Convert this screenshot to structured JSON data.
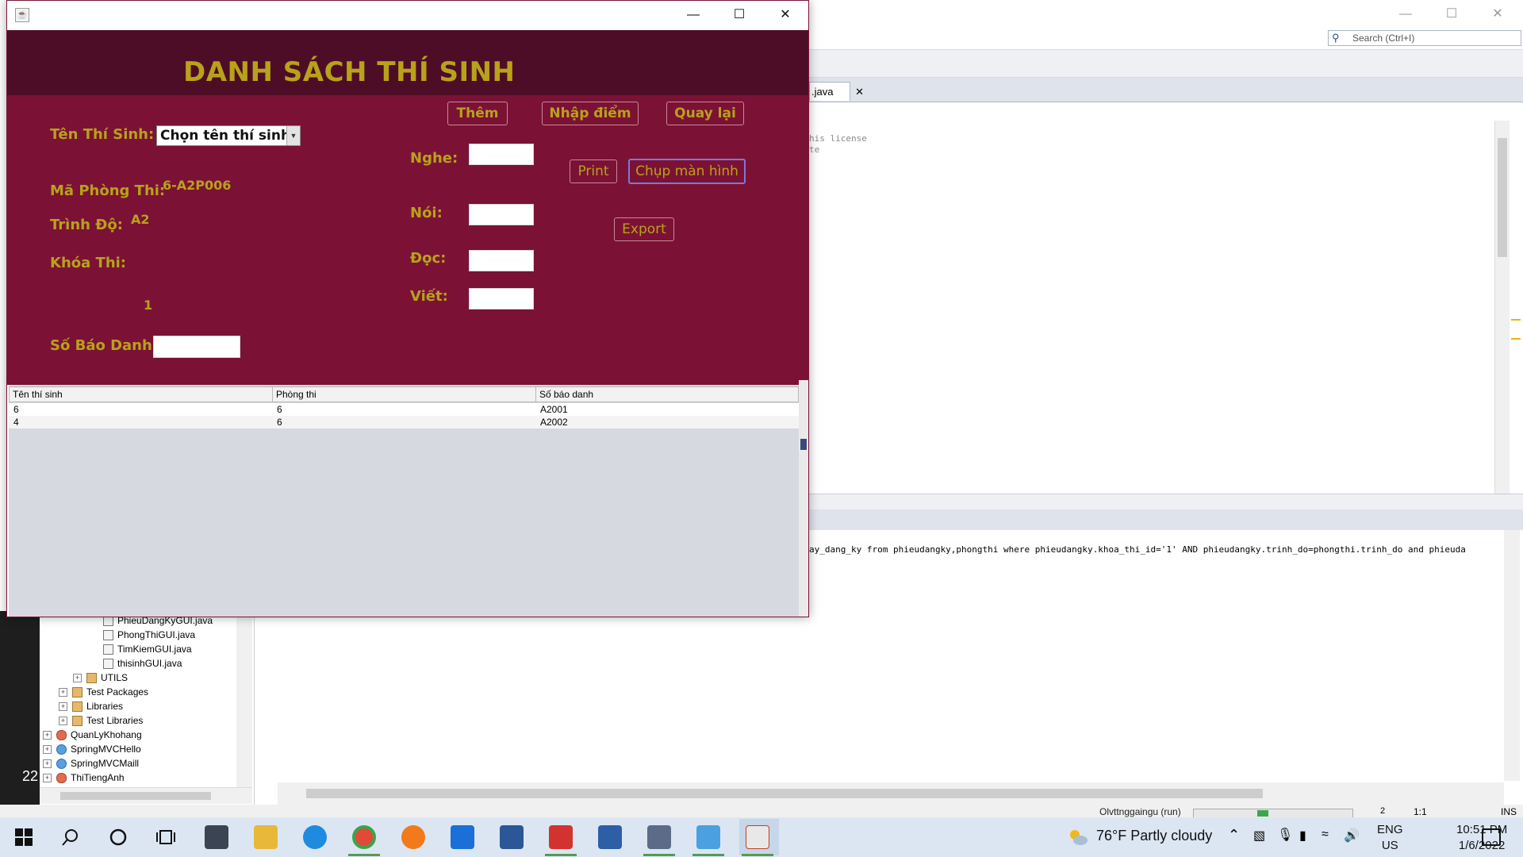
{
  "ide": {
    "search_placeholder": "Search (Ctrl+I)",
    "editor_tab": ".java",
    "editor_lines": [
      "his license",
      "te"
    ],
    "output_line": "ay_dang_ky from phieudangky,phongthi where phieudangky.khoa_thi_id='1' AND phieudangky.trinh_do=phongthi.trinh_do and phieuda",
    "tree": [
      {
        "label": "PhieuDangKyGUI.java",
        "kind": "file"
      },
      {
        "label": "PhongThiGUI.java",
        "kind": "file"
      },
      {
        "label": "TimKiemGUI.java",
        "kind": "file"
      },
      {
        "label": "thisinhGUI.java",
        "kind": "file"
      },
      {
        "label": "UTILS",
        "kind": "pkg"
      },
      {
        "label": "Test Packages",
        "kind": "pkg"
      },
      {
        "label": "Libraries",
        "kind": "pkg"
      },
      {
        "label": "Test Libraries",
        "kind": "pkg"
      },
      {
        "label": "QuanLyKhohang",
        "kind": "proj"
      },
      {
        "label": "SpringMVCHello",
        "kind": "web"
      },
      {
        "label": "SpringMVCMaill",
        "kind": "web"
      },
      {
        "label": "ThiTiengAnh",
        "kind": "proj"
      }
    ],
    "left_number": "22",
    "status": {
      "run_label": "Olvttnggaingu (run)",
      "badge": "2",
      "position": "1:1",
      "mode": "INS"
    }
  },
  "app": {
    "title": "DANH SÁCH THÍ SINH",
    "labels": {
      "ten_thi_sinh": "Tên Thí Sinh:",
      "ma_phong_thi": "Mã Phòng Thi:",
      "trinh_do": "Trình Độ:",
      "khoa_thi": "Khóa Thi:",
      "so_bao_danh": "Số Báo Danh:",
      "nghe": "Nghe:",
      "noi": "Nói:",
      "doc": "Đọc:",
      "viet": "Viết:"
    },
    "values": {
      "combo_selected": "Chọn tên thí sinh",
      "ma_phong_thi": "6-A2P006",
      "trinh_do": "A2",
      "khoa_thi": "1",
      "so_bao_danh": "",
      "nghe": "",
      "noi": "",
      "doc": "",
      "viet": ""
    },
    "buttons": {
      "them": "Thêm",
      "nhap_diem": "Nhập điểm",
      "quay_lai": "Quay lại",
      "print": "Print",
      "chup_man_hinh": "Chụp màn hình",
      "export": "Export"
    },
    "table": {
      "columns": [
        "Tên thí sinh",
        "Phòng thi",
        "Số báo danh"
      ],
      "rows": [
        [
          "6",
          "6",
          "A2001"
        ],
        [
          "4",
          "6",
          "A2002"
        ]
      ]
    },
    "colors": {
      "header_bg": "#4e0d26",
      "panel_bg": "#7b1235",
      "gold_text": "#b8a21a"
    }
  },
  "taskbar": {
    "weather": "76°F  Partly cloudy",
    "lang_line1": "ENG",
    "lang_line2": "US",
    "time": "10:51 PM",
    "date": "1/6/2022",
    "apps": [
      "windows-start-icon",
      "search-icon",
      "cortana-icon",
      "task-view-icon",
      "mail-icon",
      "file-explorer-icon",
      "edge-icon",
      "chrome-icon",
      "firefox-icon",
      "dropbox-icon",
      "word-icon",
      "visual-paradigm-icon",
      "virtualbox-icon",
      "sql-server-icon",
      "box-icon",
      "java-icon"
    ]
  }
}
